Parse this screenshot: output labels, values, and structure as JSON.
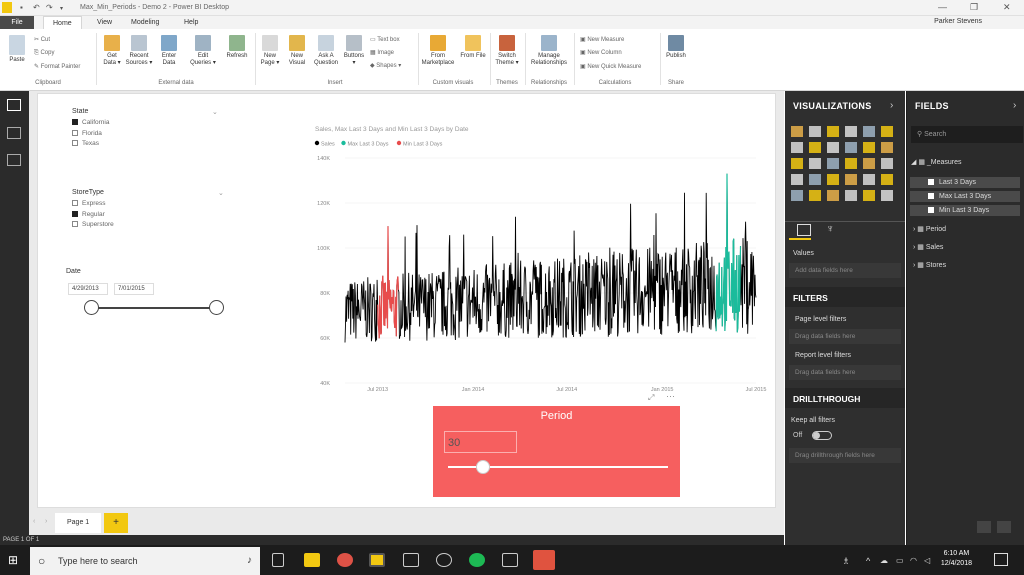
{
  "titlebar": {
    "title": "Max_Min_Periods - Demo 2 - Power BI Desktop",
    "min": "—",
    "restore": "❐",
    "close": "✕"
  },
  "tabs": [
    "File",
    "Home",
    "View",
    "Modeling",
    "Help"
  ],
  "user": "Parker Stevens",
  "ribbon": {
    "clipboard": {
      "paste": "Paste",
      "cut": "Cut",
      "copy": "Copy",
      "format_painter": "Format Painter",
      "group": "Clipboard"
    },
    "external": {
      "get_data": "Get Data",
      "recent_sources": "Recent Sources",
      "enter_data": "Enter Data",
      "edit_queries": "Edit Queries",
      "refresh": "Refresh",
      "group": "External data"
    },
    "insert": {
      "new_page": "New Page",
      "new_visual": "New Visual",
      "ask_question": "Ask A Question",
      "buttons": "Buttons",
      "text_box": "Text box",
      "image": "Image",
      "shapes": "Shapes",
      "group": "Insert"
    },
    "custom": {
      "from_marketplace": "From Marketplace",
      "from_file": "From File",
      "group": "Custom visuals"
    },
    "themes": {
      "switch_theme": "Switch Theme",
      "group": "Themes"
    },
    "relationships": {
      "manage": "Manage Relationships",
      "group": "Relationships"
    },
    "calculations": {
      "new_measure": "New Measure",
      "new_column": "New Column",
      "new_quick_measure": "New Quick Measure",
      "group": "Calculations"
    },
    "share": {
      "publish": "Publish",
      "group": "Share"
    }
  },
  "slicers": {
    "state": {
      "title": "State",
      "items": [
        {
          "label": "California",
          "checked": true
        },
        {
          "label": "Florida",
          "checked": false
        },
        {
          "label": "Texas",
          "checked": false
        }
      ]
    },
    "storetype": {
      "title": "StoreType",
      "items": [
        {
          "label": "Express",
          "checked": false
        },
        {
          "label": "Regular",
          "checked": true
        },
        {
          "label": "Superstore",
          "checked": false
        }
      ]
    },
    "date": {
      "title": "Date",
      "start": "4/29/2013",
      "end": "7/01/2015"
    }
  },
  "chart_data": {
    "type": "line",
    "title": "Sales, Max Last 3 Days and Min Last 3 Days by Date",
    "series": [
      {
        "name": "Sales",
        "color": "#000000"
      },
      {
        "name": "Max Last 3 Days",
        "color": "#1abc9c"
      },
      {
        "name": "Min Last 3 Days",
        "color": "#e84c4c"
      }
    ],
    "ylim": [
      40000,
      140000
    ],
    "yticks": [
      "40K",
      "60K",
      "80K",
      "100K",
      "120K",
      "140K"
    ],
    "xticks": [
      "Jul 2013",
      "Jan 2014",
      "Jul 2014",
      "Jan 2015",
      "Jul 2015"
    ],
    "xlim": [
      "2013-04-29",
      "2015-07-01"
    ],
    "sales_range_typical": [
      60000,
      105000
    ],
    "sales_peak": 133000,
    "sales_min": 47000,
    "min_highlight_period": [
      "2013-07-01",
      "2013-08-10"
    ],
    "max_highlight_period": [
      "2015-04-15",
      "2015-06-01"
    ]
  },
  "period": {
    "title": "Period",
    "value": "30",
    "slider_fraction": 0.16
  },
  "pages": {
    "page1": "Page 1",
    "add": "+"
  },
  "status": "PAGE 1 OF 1",
  "viz": {
    "title": "VISUALIZATIONS",
    "values": "Values",
    "add_fields": "Add data fields here",
    "filters": "FILTERS",
    "page_filters": "Page level filters",
    "drag_here": "Drag data fields here",
    "report_filters": "Report level filters",
    "drag_here2": "Drag data fields here",
    "drillthrough": "DRILLTHROUGH",
    "keep_all": "Keep all filters",
    "off": "Off",
    "drag_drill": "Drag drillthrough fields here"
  },
  "fields": {
    "title": "FIELDS",
    "search": "Search",
    "measures": "_Measures",
    "m1": "Last 3 Days",
    "m2": "Max Last 3 Days",
    "m3": "Min Last 3 Days",
    "t1": "Period",
    "t2": "Sales",
    "t3": "Stores"
  },
  "taskbar": {
    "search": "Type here to search",
    "time": "6:10 AM",
    "date": "12/4/2018"
  }
}
